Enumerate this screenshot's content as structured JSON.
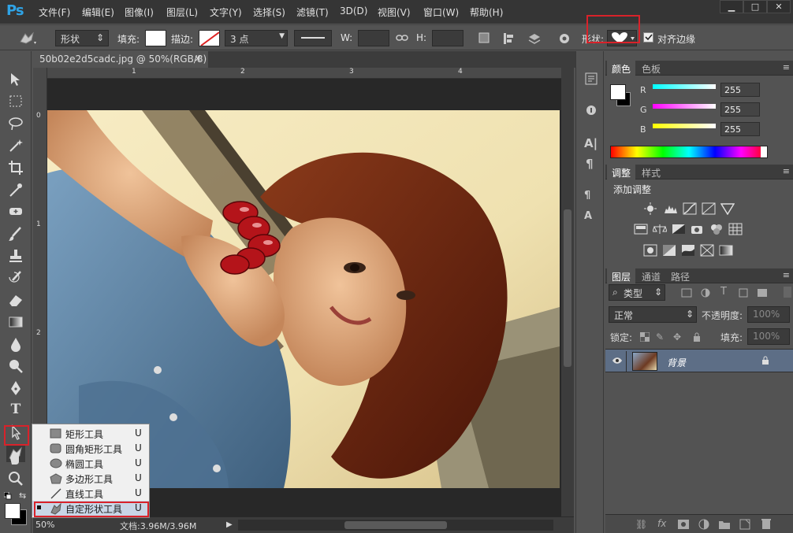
{
  "app": {
    "logo": "Ps"
  },
  "menubar": {
    "items": [
      "文件(F)",
      "编辑(E)",
      "图像(I)",
      "图层(L)",
      "文字(Y)",
      "选择(S)",
      "滤镜(T)",
      "3D(D)",
      "视图(V)",
      "窗口(W)",
      "帮助(H)"
    ],
    "window_buttons": [
      "▁",
      "□",
      "✕"
    ]
  },
  "options": {
    "mode": "形状",
    "fill_label": "填充:",
    "stroke_label": "描边:",
    "stroke_width": "3 点",
    "w_label": "W:",
    "h_label": "H:",
    "shape_label": "形状:",
    "align_edges": "对齐边缘"
  },
  "document": {
    "tab_title": "50b02e2d5cadc.jpg @ 50%(RGB/8)",
    "close": "×"
  },
  "rulers": {
    "top": [
      "1",
      "2",
      "3",
      "4"
    ],
    "left": [
      "0",
      "1",
      "2"
    ]
  },
  "status": {
    "zoom": "50%",
    "doc_info": "文档:3.96M/3.96M"
  },
  "flyout": {
    "items": [
      {
        "label": "矩形工具",
        "key": "U",
        "icon": "rectangle-icon"
      },
      {
        "label": "圆角矩形工具",
        "key": "U",
        "icon": "rounded-rect-icon"
      },
      {
        "label": "椭圆工具",
        "key": "U",
        "icon": "ellipse-icon"
      },
      {
        "label": "多边形工具",
        "key": "U",
        "icon": "polygon-icon"
      },
      {
        "label": "直线工具",
        "key": "U",
        "icon": "line-icon"
      },
      {
        "label": "自定形状工具",
        "key": "U",
        "icon": "custom-shape-icon",
        "selected": true
      }
    ]
  },
  "color_panel": {
    "tabs": [
      "颜色",
      "色板"
    ],
    "channels": [
      {
        "label": "R",
        "value": "255",
        "color": "#00ffff"
      },
      {
        "label": "G",
        "value": "255",
        "color": "#ff00ff"
      },
      {
        "label": "B",
        "value": "255",
        "color": "#ffff00"
      }
    ]
  },
  "adjust_panel": {
    "tabs": [
      "调整",
      "样式"
    ],
    "title": "添加调整"
  },
  "layers_panel": {
    "tabs": [
      "图层",
      "通道",
      "路径"
    ],
    "filter_kind": "类型",
    "blend_mode": "正常",
    "opacity_label": "不透明度:",
    "opacity_value": "100%",
    "lock_label": "锁定:",
    "fill_label": "填充:",
    "fill_value": "100%",
    "layers": [
      {
        "name": "背景"
      }
    ]
  },
  "colors": {
    "accent_highlight": "#d9222a",
    "ps_blue": "#2fa3e6"
  }
}
